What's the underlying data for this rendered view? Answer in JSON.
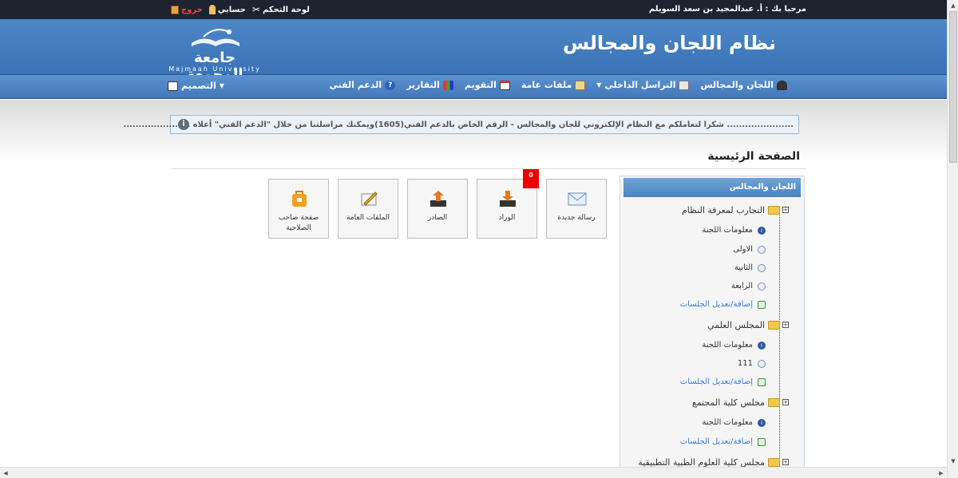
{
  "topbar": {
    "welcome": "مرحبا بك : أ. عبدالمجيد بن سعد السويلم",
    "control_panel": "لوحة التحكم",
    "my_account": "حسابي",
    "logout": "خروج"
  },
  "header": {
    "system_title": "نظام اللجان والمجالس",
    "logo_arabic": "جامعة المجمعة",
    "logo_english": "Majmaah University"
  },
  "nav": {
    "items": [
      {
        "label": "اللجان والمجالس",
        "icon": "committees-icon"
      },
      {
        "label": "التراسل الداخلي",
        "icon": "messaging-icon",
        "dropdown": true
      },
      {
        "label": "ملفات عامة",
        "icon": "files-icon"
      },
      {
        "label": "التقويم",
        "icon": "calendar-icon"
      },
      {
        "label": "التقارير",
        "icon": "reports-icon"
      },
      {
        "label": "الدعم الفني",
        "icon": "help-icon"
      }
    ],
    "design": "التصميم"
  },
  "notice": {
    "text": "...................... شكرا لتعاملكم مع النظام الإلكتروني للجان والمجالس - الرقم الخاص بالدعم الفني(1605)ويمكنك مراسلتنا من خلال \"الدعم الفني\" أعلاه ......................"
  },
  "page_title": "الصفحة الرئيسية",
  "tiles": [
    {
      "label": "رسالة جديدة",
      "icon": "envelope-icon"
    },
    {
      "label": "الوراد",
      "icon": "inbox-icon",
      "badge": "0"
    },
    {
      "label": "الصادر",
      "icon": "outbox-icon"
    },
    {
      "label": "الملفات العامة",
      "icon": "edit-files-icon"
    },
    {
      "label": "صفحة صاحب الصلاحية",
      "icon": "authority-icon"
    }
  ],
  "tree": {
    "header": "اللجان والمجالس",
    "nodes": [
      {
        "title": "التجارب لمعرفة النظام",
        "info": "معلومات اللجنة",
        "sessions": [
          "الاولى",
          "الثانية",
          "الرابعة"
        ],
        "add": "إضافة/تعديل الجلسات"
      },
      {
        "title": "المجلس العلمي",
        "info": "معلومات اللجنة",
        "sessions": [
          "111"
        ],
        "add": "إضافة/تعديل الجلسات"
      },
      {
        "title": "مجلس كلية المجتمع",
        "info": "معلومات اللجنة",
        "sessions": [],
        "add": "إضافة/تعديل الجلسات"
      },
      {
        "title": "مجلس كلية العلوم الطبية التطبيقية"
      }
    ]
  },
  "colors": {
    "topbar": "#1d2430",
    "banner": "#4a7fc0",
    "logout": "#ff4040",
    "badge": "#ee0000"
  }
}
